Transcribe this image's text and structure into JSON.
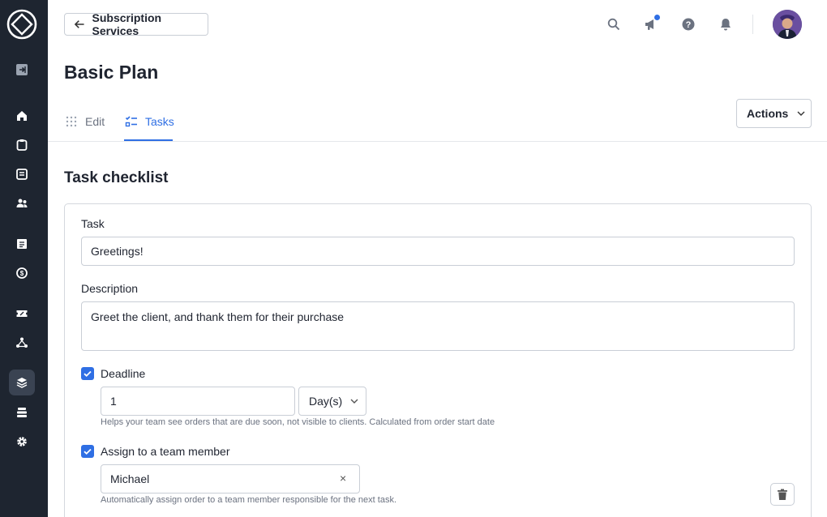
{
  "header": {
    "back_label": "Subscription Services"
  },
  "page": {
    "title": "Basic Plan"
  },
  "tabs": [
    {
      "label": "Edit",
      "active": false
    },
    {
      "label": "Tasks",
      "active": true
    }
  ],
  "actions": {
    "label": "Actions"
  },
  "checklist": {
    "title": "Task checklist",
    "task": {
      "label": "Task",
      "value": "Greetings!"
    },
    "description": {
      "label": "Description",
      "value": "Greet the client, and thank them for their purchase"
    },
    "deadline": {
      "label": "Deadline",
      "checked": true,
      "amount": "1",
      "unit": "Day(s)",
      "help": "Helps your team see orders that are due soon, not visible to clients. Calculated from order start date"
    },
    "assign": {
      "label": "Assign to a team member",
      "checked": true,
      "value": "Michael",
      "clear_symbol": "×",
      "help": "Automatically assign order to a team member responsible for the next task."
    }
  },
  "colors": {
    "sidebar_bg": "#1e2530",
    "accent": "#2f6fe4",
    "notification_dot": "#2f6fe4"
  },
  "icons": {
    "sidebar": [
      "logo-icon",
      "collapse-icon",
      "home-icon",
      "orders-icon",
      "messages-icon",
      "clients-icon",
      "invoices-icon",
      "billing-icon",
      "coupons-icon",
      "affiliates-icon",
      "services-icon",
      "storage-icon",
      "settings-icon"
    ],
    "topbar": [
      "search-icon",
      "announcements-icon",
      "help-icon",
      "bell-icon"
    ]
  }
}
